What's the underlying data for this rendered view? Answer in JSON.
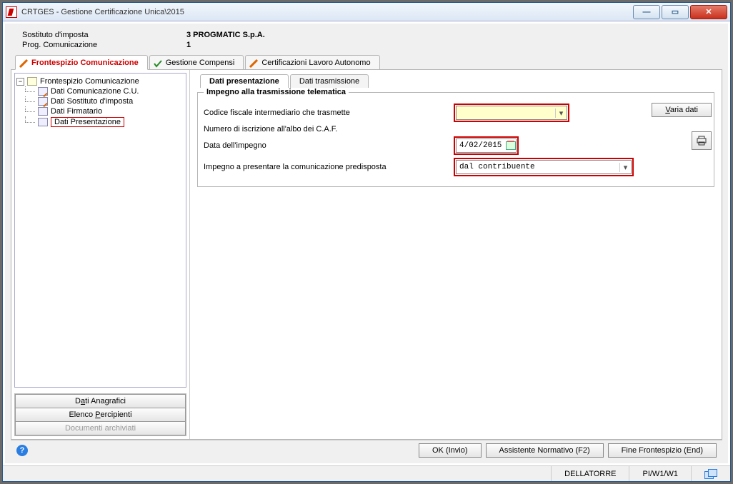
{
  "window": {
    "title": "CRTGES - Gestione Certificazione Unica\\2015"
  },
  "header": {
    "row1_label": "Sostituto d'imposta",
    "row1_value": "3 PROGMATIC S.p.A.",
    "row2_label": "Prog. Comunicazione",
    "row2_value": "1"
  },
  "main_tabs": {
    "t0": "Frontespizio Comunicazione",
    "t1": "Gestione Compensi",
    "t2": "Certificazioni Lavoro Autonomo",
    "active_index": 0
  },
  "tree": {
    "root": "Frontespizio Comunicazione",
    "n0": "Dati Comunicazione C.U.",
    "n1": "Dati Sostituto d'imposta",
    "n2": "Dati Firmatario",
    "n3": "Dati Presentazione"
  },
  "left_buttons": {
    "b0": "Dati Anagrafici",
    "b1": "Elenco Percipienti",
    "b2": "Documenti archiviati"
  },
  "sub_tabs": {
    "s0": "Dati presentazione",
    "s1": "Dati trasmissione"
  },
  "fieldset": {
    "legend": "Impegno alla trasmissione telematica",
    "f0_label": "Codice fiscale intermediario che trasmette",
    "f0_value": "",
    "f1_label": "Numero di iscrizione all'albo dei C.A.F.",
    "f2_label": "Data dell'impegno",
    "f2_value": "4/02/2015",
    "f3_label": "Impegno a presentare la comunicazione predisposta",
    "f3_value": "dal contribuente"
  },
  "right_actions": {
    "varia": "Varia dati"
  },
  "footer": {
    "ok": "OK (Invio)",
    "assist": "Assistente Normativo (F2)",
    "fine": "Fine Frontespizio (End)"
  },
  "status": {
    "user": "DELLATORRE",
    "path": "PI/W1/W1"
  }
}
